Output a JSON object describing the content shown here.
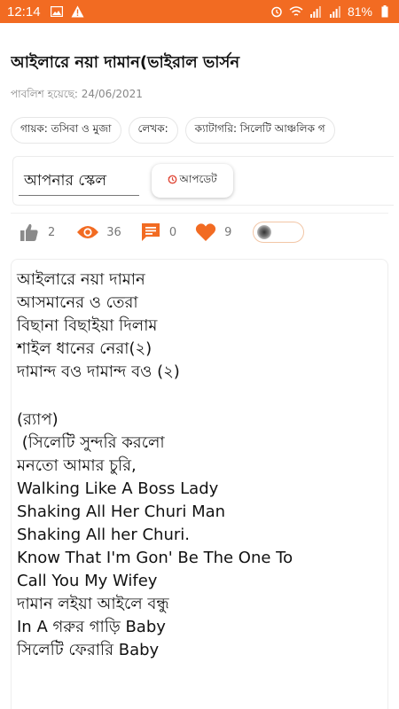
{
  "status_bar": {
    "time": "12:14",
    "battery": "81%",
    "color": "#f26b22",
    "left_icons": [
      "image-icon",
      "warning-icon"
    ],
    "right_icons": [
      "alarm-icon",
      "wifi-icon",
      "signal-icon",
      "signal-icon",
      "battery-icon"
    ]
  },
  "song": {
    "title": "আইলারে নয়া দামান(ভাইরাল ভার্সন",
    "published": "পাবলিশ হয়েছে: 24/06/2021"
  },
  "chips": [
    {
      "label": "গায়ক: তসিবা ও মুজা"
    },
    {
      "label": "লেখক:"
    },
    {
      "label": "ক্যাটাগরি: সিলেটি আঞ্চলিক গ"
    }
  ],
  "scale": {
    "field_text": "আপনার স্কেল",
    "update_label": "আপডেট"
  },
  "stats": {
    "likes": "2",
    "views": "36",
    "comments": "0",
    "hearts": "9",
    "accent_color": "#f26b22"
  },
  "lyrics": [
    "আইলারে নয়া দামান",
    "আসমানের ও তেরা",
    "বিছানা বিছাইয়া দিলাম",
    "শাইল ধানের নেরা(২)",
    "দামান্দ বও দামান্দ বও (২)",
    "",
    "(র‍্যাপ)",
    " (সিলেটি সুন্দরি করলো",
    "মনতো আমার চুরি,",
    "Walking Like A Boss Lady",
    "Shaking All Her Churi Man",
    "Shaking All her Churi.",
    "Know That I'm Gon' Be The One To",
    "Call You My Wifey",
    "দামান লইয়া আইলে বন্ধু",
    "In A গরুর গাড়ি Baby",
    "সিলেটি ফেরারি Baby"
  ]
}
